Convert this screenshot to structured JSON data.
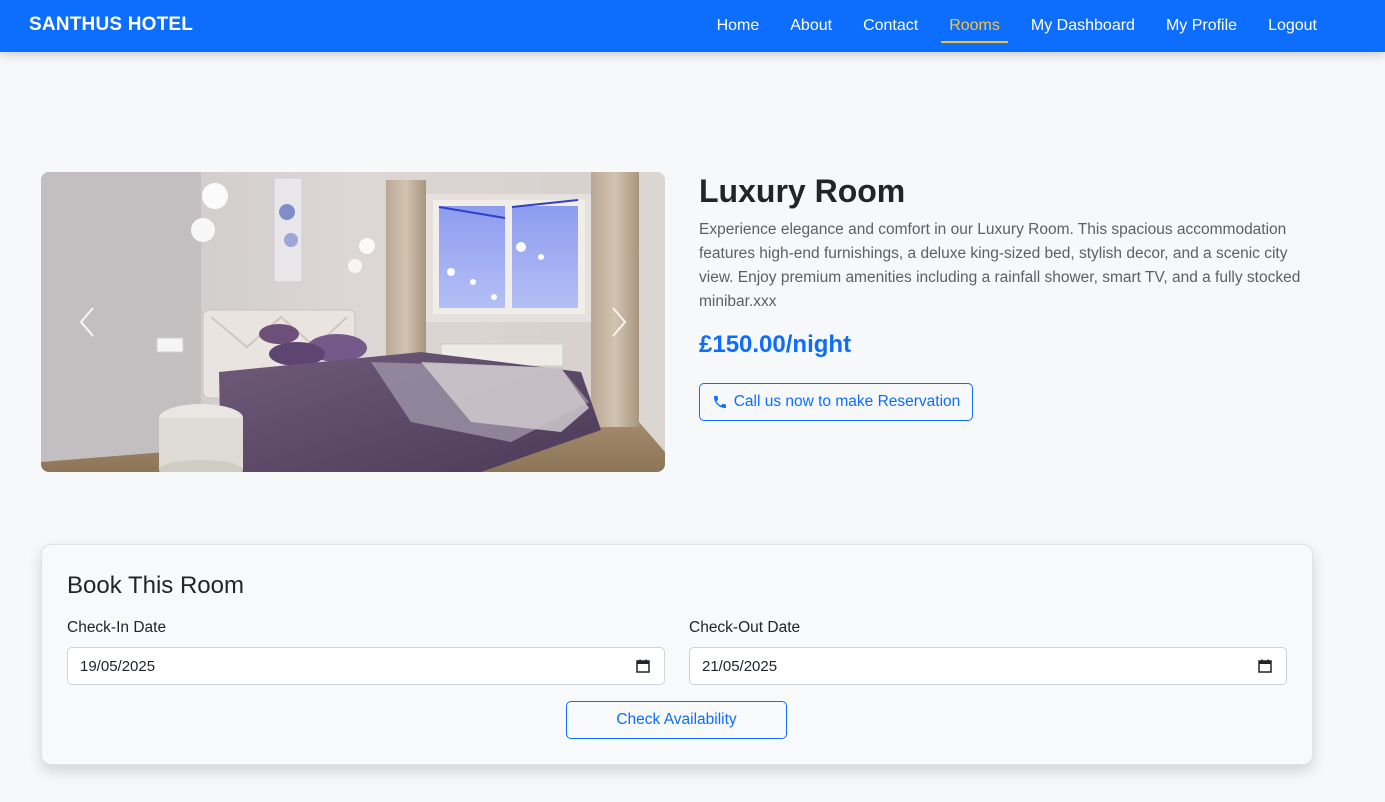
{
  "brand": "SANTHUS HOTEL",
  "nav": {
    "home": "Home",
    "about": "About",
    "contact": "Contact",
    "rooms": "Rooms",
    "dashboard": "My Dashboard",
    "profile": "My Profile",
    "logout": "Logout",
    "active": "Rooms"
  },
  "room": {
    "title": "Luxury Room",
    "description": "Experience elegance and comfort in our Luxury Room. This spacious accommodation features high-end furnishings, a deluxe king-sized bed, stylish decor, and a scenic city view. Enjoy premium amenities including a rainfall shower, smart TV, and a fully stocked minibar.xxx",
    "price": "£150.00/night",
    "call_button": "Call us now to make Reservation"
  },
  "booking": {
    "title": "Book This Room",
    "checkin_label": "Check-In Date",
    "checkin_value": "19/05/2025",
    "checkout_label": "Check-Out Date",
    "checkout_value": "21/05/2025",
    "check_button": "Check Availability"
  },
  "colors": {
    "primary": "#0d6efd",
    "active_nav": "#f4c542",
    "background": "#f6f8fa"
  },
  "icons": {
    "carousel_prev": "chevron-left-icon",
    "carousel_next": "chevron-right-icon",
    "call": "phone-icon",
    "calendar": "calendar-icon"
  }
}
